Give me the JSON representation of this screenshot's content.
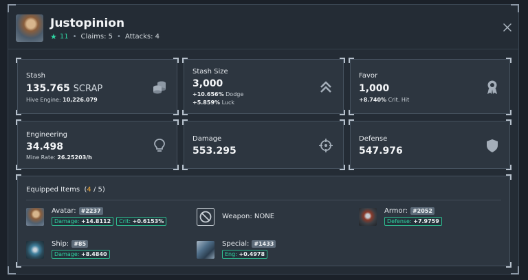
{
  "header": {
    "title": "Justopinion",
    "level": "11",
    "claims": "Claims: 5",
    "attacks": "Attacks: 4",
    "separator": "•"
  },
  "stats": {
    "stash": {
      "label": "Stash",
      "value": "135.765",
      "unit": "SCRAP",
      "sub_label": "Hive Engine:",
      "sub_value": "10,226.079"
    },
    "stash_size": {
      "label": "Stash Size",
      "value": "3,000",
      "sub1_value": "+10.656%",
      "sub1_label": "Dodge",
      "sub2_value": "+5.859%",
      "sub2_label": "Luck"
    },
    "favor": {
      "label": "Favor",
      "value": "1,000",
      "sub_value": "+8.740%",
      "sub_label": "Crit. Hit"
    },
    "engineering": {
      "label": "Engineering",
      "value": "34.498",
      "sub_label": "Mine Rate:",
      "sub_value": "26.25203/h"
    },
    "damage": {
      "label": "Damage",
      "value": "553.295"
    },
    "defense": {
      "label": "Defense",
      "value": "547.976"
    }
  },
  "equipped": {
    "title": "Equipped Items",
    "count": "4",
    "total": "5",
    "items": [
      {
        "slot": "Avatar:",
        "id": "#2237",
        "chips": [
          {
            "label": "Damage:",
            "value": "+14.8112"
          },
          {
            "label": "Crit:",
            "value": "+0.6153%"
          }
        ]
      },
      {
        "slot": "Weapon: NONE"
      },
      {
        "slot": "Armor:",
        "id": "#2052",
        "chips": [
          {
            "label": "Defense:",
            "value": "+7.9759"
          }
        ]
      },
      {
        "slot": "Ship:",
        "id": "#85",
        "chips": [
          {
            "label": "Damage:",
            "value": "+8.4840"
          }
        ]
      },
      {
        "slot": "Special:",
        "id": "#1433",
        "chips": [
          {
            "label": "Eng:",
            "value": "+0.4978"
          }
        ]
      }
    ]
  },
  "colors": {
    "accent": "#2fd6a3",
    "count": "#f0a637",
    "panel": "#2d3640",
    "background": "#1b2129"
  }
}
